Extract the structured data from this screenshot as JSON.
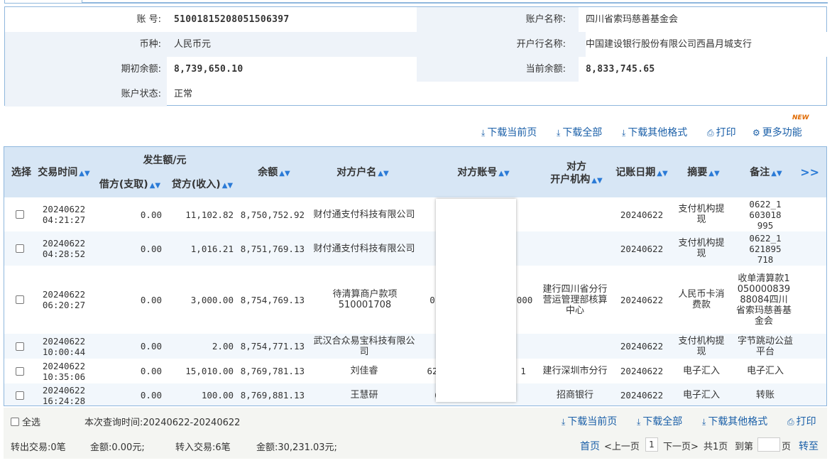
{
  "account_info": {
    "account_no_label": "账    号:",
    "account_no": "51001815208051506397",
    "account_name_label": "账户名称:",
    "account_name": "四川省索玛慈善基金会",
    "currency_label": "币种:",
    "currency": "人民币元",
    "bank_label": "开户行名称:",
    "bank": "中国建设银行股份有限公司西昌月城支行",
    "opening_balance_label": "期初余额:",
    "opening_balance": "8,739,650.10",
    "current_balance_label": "当前余额:",
    "current_balance": "8,833,745.65",
    "status_label": "账户状态:",
    "status": "正常"
  },
  "toolbar": {
    "download_page": "下载当前页",
    "download_all": "下载全部",
    "download_other": "下载其他格式",
    "print": "打印",
    "more_functions": "更多功能",
    "new_badge": "NEW"
  },
  "table": {
    "headers": {
      "select": "选择",
      "time": "交易时间",
      "amount_group": "发生额/元",
      "debit": "借方(支取)",
      "credit": "贷方(收入)",
      "balance": "余额",
      "counter_name": "对方户名",
      "counter_account": "对方账号",
      "counter_bank_line1": "对方",
      "counter_bank_line2": "开户机构",
      "post_date": "记账日期",
      "summary": "摘要",
      "remark": "备注",
      "more": ">>"
    },
    "rows": [
      {
        "date": "20240622",
        "time": "04:21:27",
        "debit": "0.00",
        "credit": "11,102.82",
        "balance": "8,750,752.92",
        "counter_name": "财付通支付科技有限公司",
        "counter_account": "",
        "counter_bank": "",
        "post_date": "20240622",
        "summary": "支付机构提现",
        "remark": "0622_1603018995"
      },
      {
        "date": "20240622",
        "time": "04:28:52",
        "debit": "0.00",
        "credit": "1,016.21",
        "balance": "8,751,769.13",
        "counter_name": "财付通支付科技有限公司",
        "counter_account": "",
        "counter_bank": "",
        "post_date": "20240622",
        "summary": "支付机构提现",
        "remark": "0622_1621895718"
      },
      {
        "date": "20240622",
        "time": "06:20:27",
        "debit": "0.00",
        "credit": "3,000.00",
        "balance": "8,754,769.13",
        "counter_name": "待清算商户款项510001708",
        "counter_account_left": "0",
        "counter_account_right": "000",
        "counter_bank": "建行四川省分行营运管理部核算中心",
        "post_date": "20240622",
        "summary": "人民币卡消费款",
        "remark": "收单清算款10500008398808​4四川省索玛慈善基金会"
      },
      {
        "date": "20240622",
        "time": "10:00:44",
        "debit": "0.00",
        "credit": "2.00",
        "balance": "8,754,771.13",
        "counter_name": "武汉合众易宝科技有限公司",
        "counter_account": "",
        "counter_bank": "",
        "post_date": "20240622",
        "summary": "支付机构提现",
        "remark": "字节跳动公益平台"
      },
      {
        "date": "20240622",
        "time": "10:35:06",
        "debit": "0.00",
        "credit": "15,010.00",
        "balance": "8,769,781.13",
        "counter_name": "刘佳睿",
        "counter_account_left": "62",
        "counter_account_right": "1",
        "counter_bank": "建行深圳市分行",
        "post_date": "20240622",
        "summary": "电子汇入",
        "remark": "电子汇入"
      },
      {
        "date": "20240622",
        "time": "16:24:28",
        "debit": "0.00",
        "credit": "100.00",
        "balance": "8,769,881.13",
        "counter_name": "王慧研",
        "counter_account_left": "6",
        "counter_account_right": "",
        "counter_bank": "招商银行",
        "post_date": "20240622",
        "summary": "电子汇入",
        "remark": "转账"
      }
    ]
  },
  "footer": {
    "select_all": "全选",
    "query_time": "本次查询时间:20240622-20240622",
    "download_page": "下载当前页",
    "download_all": "下载全部",
    "download_other": "下载其他格式",
    "print": "打印",
    "out_count": "转出交易:0笔",
    "out_amount": "金额:0.00元;",
    "in_count": "转入交易:6笔",
    "in_amount": "金额:30,231.03元;",
    "first_page": "首页",
    "prev_page": "<上一页",
    "current_page": "1",
    "next_page": "下一页>",
    "total_pages": "共1页",
    "goto_label": "到第",
    "page_unit": "页",
    "goto_button": "转至"
  }
}
